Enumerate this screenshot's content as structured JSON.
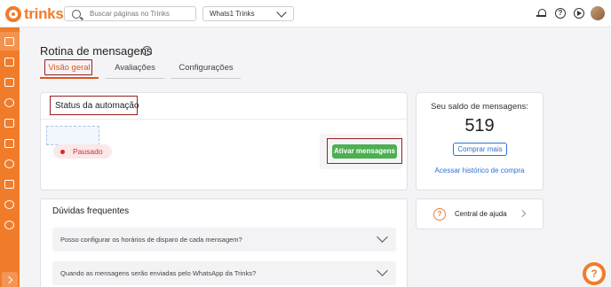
{
  "app": {
    "logo_text": "trinks"
  },
  "search": {
    "placeholder": "Buscar páginas no Trinks"
  },
  "account_select": {
    "value": "Whats1 Trinks"
  },
  "header_icons": [
    "bell-icon",
    "help-icon",
    "play-icon",
    "avatar"
  ],
  "sidebar": {
    "items": [
      "home-icon",
      "calendar-icon",
      "table-icon",
      "money-icon",
      "presentation-icon",
      "megaphone-icon",
      "settings-icon",
      "clipboard-icon",
      "users-icon",
      "share-icon"
    ],
    "active_index": 0
  },
  "page": {
    "title": "Rotina de mensagens",
    "tabs": [
      {
        "label": "Visão geral",
        "active": true
      },
      {
        "label": "Avaliações",
        "active": false
      },
      {
        "label": "Configurações",
        "active": false
      }
    ]
  },
  "status": {
    "title": "Status da automação",
    "state_label": "Pausado",
    "activate_label": "Ativar mensagens"
  },
  "balance": {
    "label": "Seu saldo de mensagens:",
    "value": "519",
    "buy_label": "Comprar mais",
    "history_link": "Acessar histórico de compra"
  },
  "faq": {
    "title": "Dúvidas frequentes",
    "items": [
      {
        "question": "Posso configurar os horários de disparo de cada mensagem?"
      },
      {
        "question": "Quando as mensagens serão enviadas pelo WhatsApp da Trinks?"
      }
    ]
  },
  "help_center": {
    "label": "Central de ajuda"
  },
  "colors": {
    "brand": "#f07c2a",
    "active_tab": "#e2541b",
    "success": "#4caf50",
    "link": "#2e6fd1",
    "paused": "#d62b2b"
  }
}
